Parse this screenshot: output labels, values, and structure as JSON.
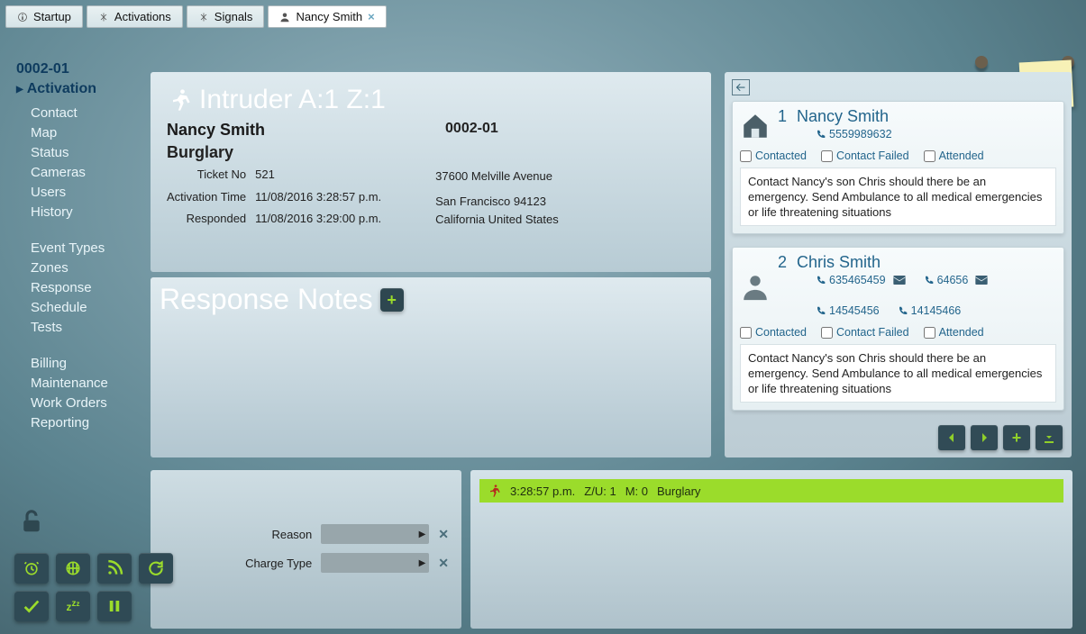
{
  "tabs": [
    {
      "label": "Startup"
    },
    {
      "label": "Activations"
    },
    {
      "label": "Signals"
    },
    {
      "label": "Nancy Smith",
      "active": true,
      "closable": true
    }
  ],
  "sidebar": {
    "account": "0002-01",
    "active": "Activation",
    "group1": [
      "Contact",
      "Map",
      "Status",
      "Cameras",
      "Users",
      "History"
    ],
    "group2": [
      "Event Types",
      "Zones",
      "Response",
      "Schedule",
      "Tests"
    ],
    "group3": [
      "Billing",
      "Maintenance",
      "Work Orders",
      "Reporting"
    ]
  },
  "alarm": {
    "title": "Intruder A:1 Z:1",
    "name": "Nancy Smith",
    "account": "0002-01",
    "type": "Burglary",
    "ticket_label": "Ticket No",
    "ticket": "521",
    "activation_label": "Activation Time",
    "activation": "11/08/2016 3:28:57 p.m.",
    "responded_label": "Responded",
    "responded": "11/08/2016 3:29:00 p.m.",
    "addr1": "37600 Melville Avenue",
    "addr2": "San Francisco 94123",
    "addr3": "California United States"
  },
  "response_notes_title": "Response Notes",
  "contacts": [
    {
      "idx": "1",
      "name": "Nancy Smith",
      "icon": "house",
      "phones": [
        {
          "n": "5559989632"
        }
      ],
      "checks": {
        "contacted": "Contacted",
        "failed": "Contact Failed",
        "attended": "Attended"
      },
      "note": "Contact Nancy's son Chris should there be an emergency. Send Ambulance to all medical emergencies or life threatening situations"
    },
    {
      "idx": "2",
      "name": "Chris Smith",
      "icon": "person",
      "phones": [
        {
          "n": "635465459",
          "mail": true
        },
        {
          "n": "64656",
          "mail": true
        },
        {
          "n": "14545456"
        },
        {
          "n": "14145466"
        }
      ],
      "checks": {
        "contacted": "Contacted",
        "failed": "Contact Failed",
        "attended": "Attended"
      },
      "note": "Contact Nancy's son Chris should there be an emergency. Send Ambulance to all medical emergencies or life threatening situations"
    }
  ],
  "form": {
    "reason_label": "Reason",
    "charge_label": "Charge Type"
  },
  "event": {
    "time": "3:28:57 p.m.",
    "zu": "Z/U: 1",
    "m": "M: 0",
    "type": "Burglary"
  }
}
